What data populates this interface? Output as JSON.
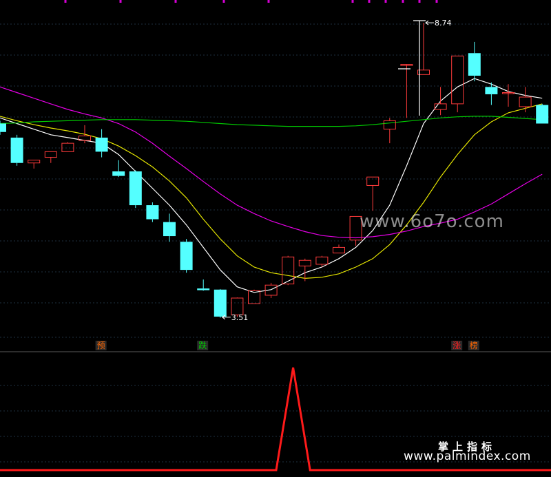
{
  "chart_data": [
    {
      "type": "candlestick",
      "panel": "main",
      "grid": true,
      "ylim": [
        3.3,
        8.9
      ],
      "candles": [
        {
          "o": 6.95,
          "h": 7.0,
          "l": 6.75,
          "c": 6.8
        },
        {
          "o": 6.7,
          "h": 6.75,
          "l": 6.2,
          "c": 6.25
        },
        {
          "o": 6.25,
          "h": 6.3,
          "l": 6.15,
          "c": 6.3
        },
        {
          "o": 6.35,
          "h": 6.45,
          "l": 6.25,
          "c": 6.45
        },
        {
          "o": 6.45,
          "h": 6.62,
          "l": 6.45,
          "c": 6.6
        },
        {
          "o": 6.65,
          "h": 6.92,
          "l": 6.6,
          "c": 6.73
        },
        {
          "o": 6.7,
          "h": 6.85,
          "l": 6.35,
          "c": 6.45
        },
        {
          "o": 6.1,
          "h": 6.3,
          "l": 6.0,
          "c": 6.02
        },
        {
          "o": 6.1,
          "h": 6.12,
          "l": 5.45,
          "c": 5.5
        },
        {
          "o": 5.5,
          "h": 5.55,
          "l": 5.2,
          "c": 5.25
        },
        {
          "o": 5.2,
          "h": 5.35,
          "l": 4.85,
          "c": 4.95
        },
        {
          "o": 4.85,
          "h": 4.9,
          "l": 4.3,
          "c": 4.35
        },
        {
          "o": 4.02,
          "h": 4.18,
          "l": 3.98,
          "c": 3.99
        },
        {
          "o": 4.0,
          "h": 4.01,
          "l": 3.5,
          "c": 3.52
        },
        {
          "o": 3.55,
          "h": 3.86,
          "l": 3.51,
          "c": 3.85
        },
        {
          "o": 3.75,
          "h": 4.0,
          "l": 3.75,
          "c": 3.98
        },
        {
          "o": 3.9,
          "h": 4.12,
          "l": 3.85,
          "c": 4.08
        },
        {
          "o": 4.1,
          "h": 4.6,
          "l": 4.08,
          "c": 4.58
        },
        {
          "o": 4.42,
          "h": 4.55,
          "l": 4.15,
          "c": 4.52
        },
        {
          "o": 4.45,
          "h": 4.6,
          "l": 4.4,
          "c": 4.58
        },
        {
          "o": 4.65,
          "h": 4.8,
          "l": 4.65,
          "c": 4.75
        },
        {
          "o": 4.88,
          "h": 5.3,
          "l": 4.78,
          "c": 5.3
        },
        {
          "o": 5.85,
          "h": 6.0,
          "l": 5.4,
          "c": 6.0
        },
        {
          "o": 6.85,
          "h": 7.05,
          "l": 6.6,
          "c": 7.0
        },
        {
          "o": 8.0,
          "h": 8.0,
          "l": 7.05,
          "c": 8.0
        },
        {
          "o": 7.82,
          "h": 8.74,
          "l": 7.82,
          "c": 7.9
        },
        {
          "o": 7.2,
          "h": 7.6,
          "l": 7.1,
          "c": 7.3
        },
        {
          "o": 7.3,
          "h": 8.15,
          "l": 7.15,
          "c": 8.15
        },
        {
          "o": 8.2,
          "h": 8.4,
          "l": 7.7,
          "c": 7.8
        },
        {
          "o": 7.6,
          "h": 7.68,
          "l": 7.28,
          "c": 7.47
        },
        {
          "o": 7.5,
          "h": 7.65,
          "l": 7.25,
          "c": 7.5
        },
        {
          "o": 7.25,
          "h": 7.6,
          "l": 7.15,
          "c": 7.42
        },
        {
          "o": 7.28,
          "h": 7.3,
          "l": 6.95,
          "c": 6.95
        }
      ],
      "moving_averages": [
        {
          "color": "#ffffff",
          "values": [
            7.05,
            6.95,
            6.85,
            6.75,
            6.7,
            6.65,
            6.6,
            6.4,
            6.1,
            5.8,
            5.5,
            5.15,
            4.75,
            4.35,
            4.05,
            3.95,
            4.0,
            4.15,
            4.3,
            4.4,
            4.55,
            4.75,
            5.05,
            5.5,
            6.2,
            6.95,
            7.35,
            7.6,
            7.75,
            7.65,
            7.52,
            7.45,
            7.4
          ]
        },
        {
          "color": "#e6e600",
          "values": [
            7.08,
            7.0,
            6.93,
            6.87,
            6.82,
            6.76,
            6.68,
            6.55,
            6.38,
            6.18,
            5.93,
            5.63,
            5.25,
            4.9,
            4.6,
            4.4,
            4.3,
            4.25,
            4.2,
            4.22,
            4.28,
            4.4,
            4.55,
            4.8,
            5.15,
            5.55,
            6.0,
            6.4,
            6.75,
            6.98,
            7.14,
            7.22,
            7.3
          ]
        },
        {
          "color": "#e600e6",
          "values": [
            7.6,
            7.5,
            7.4,
            7.3,
            7.2,
            7.12,
            7.05,
            6.95,
            6.8,
            6.6,
            6.37,
            6.15,
            5.92,
            5.7,
            5.5,
            5.35,
            5.22,
            5.12,
            5.03,
            4.96,
            4.93,
            4.92,
            4.94,
            4.98,
            5.04,
            5.12,
            5.18,
            5.25,
            5.38,
            5.52,
            5.7,
            5.88,
            6.05
          ]
        },
        {
          "color": "#00c800",
          "values": [
            6.95,
            6.96,
            6.98,
            6.99,
            7.0,
            7.01,
            7.02,
            7.02,
            7.02,
            7.01,
            7.0,
            6.99,
            6.97,
            6.95,
            6.93,
            6.92,
            6.91,
            6.9,
            6.9,
            6.9,
            6.9,
            6.91,
            6.93,
            6.96,
            6.99,
            7.02,
            7.05,
            7.07,
            7.08,
            7.08,
            7.06,
            7.04,
            7.02
          ]
        }
      ],
      "annotations": [
        {
          "index": 25,
          "price": 8.74,
          "label": "8.74"
        },
        {
          "index": 13,
          "price": 3.51,
          "label": "3.51"
        }
      ],
      "signal_tags": [
        {
          "index": 6,
          "label": "预",
          "color": "#ff6600"
        },
        {
          "index": 12,
          "label": "跌",
          "color": "#00cc00"
        },
        {
          "index": 27,
          "label": "涨",
          "color": "#ff2020"
        },
        {
          "index": 28,
          "label": "榜",
          "color": "#ff6600"
        }
      ]
    },
    {
      "type": "line",
      "panel": "indicator",
      "grid": true,
      "color": "#ff1a1a",
      "ylim": [
        0,
        1
      ],
      "x": [
        0,
        16.3,
        17.3,
        18.3,
        33
      ],
      "values": [
        0,
        0,
        1,
        0,
        0
      ]
    }
  ],
  "watermarks": {
    "site": "www.6o7o.com",
    "brand_cn": "掌上指标",
    "brand_url": "www.palmindex.com"
  }
}
